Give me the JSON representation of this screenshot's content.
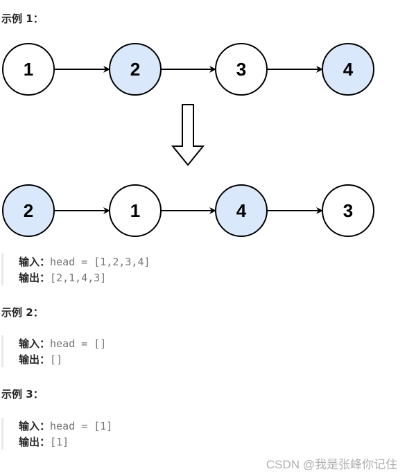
{
  "examples": [
    {
      "title": "示例 1：",
      "input_label": "输入：",
      "input_value": "head = [1,2,3,4]",
      "output_label": "输出：",
      "output_value": "[2,1,4,3]"
    },
    {
      "title": "示例 2：",
      "input_label": "输入：",
      "input_value": "head = []",
      "output_label": "输出：",
      "output_value": "[]"
    },
    {
      "title": "示例 3：",
      "input_label": "输入：",
      "input_value": "head = [1]",
      "output_label": "输出：",
      "output_value": "[1]"
    }
  ],
  "diagram": {
    "before": [
      {
        "value": "1",
        "highlighted": false
      },
      {
        "value": "2",
        "highlighted": true
      },
      {
        "value": "3",
        "highlighted": false
      },
      {
        "value": "4",
        "highlighted": true
      }
    ],
    "after": [
      {
        "value": "2",
        "highlighted": true
      },
      {
        "value": "1",
        "highlighted": false
      },
      {
        "value": "4",
        "highlighted": true
      },
      {
        "value": "3",
        "highlighted": false
      }
    ],
    "colors": {
      "highlight_fill": "#dae8fc",
      "plain_fill": "#ffffff",
      "stroke": "#000000"
    }
  },
  "watermark": "CSDN @我是张峰你记住"
}
